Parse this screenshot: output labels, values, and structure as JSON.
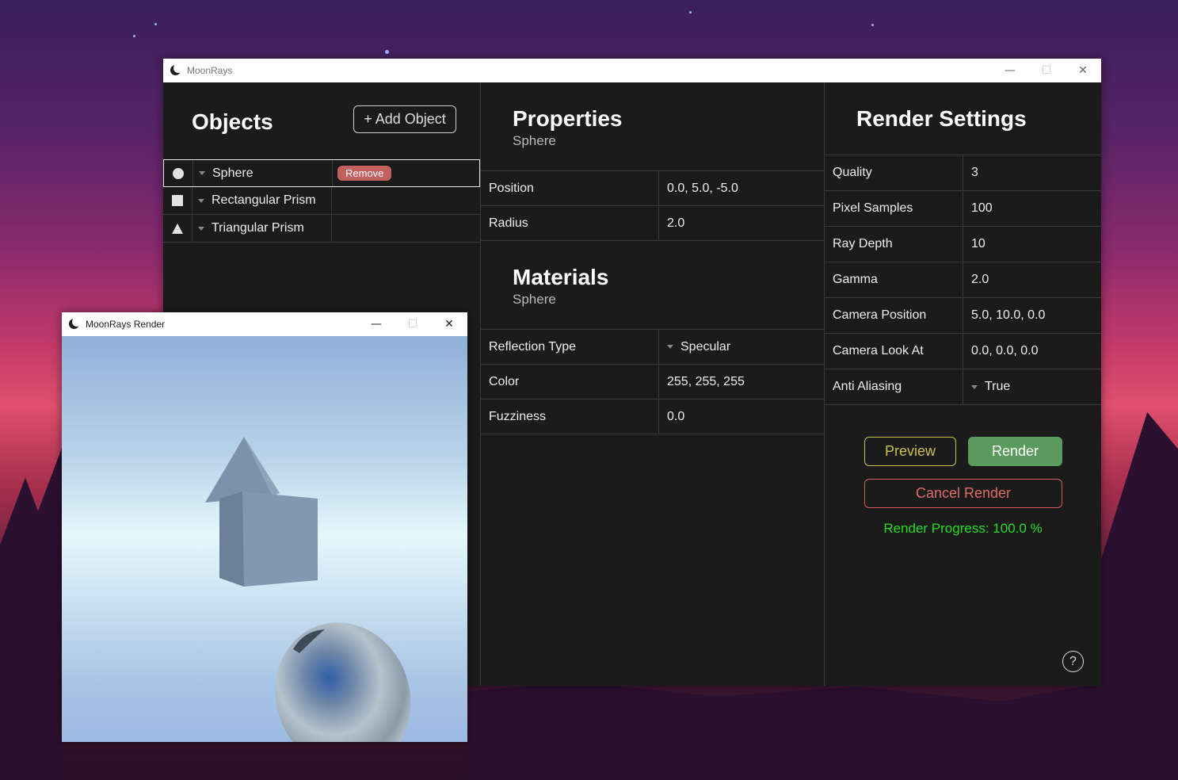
{
  "main_window": {
    "title": "MoonRays",
    "controls": {
      "minimize": "—",
      "maximize": "☐",
      "close": "✕"
    }
  },
  "objects_panel": {
    "title": "Objects",
    "add_button": "+ Add Object",
    "items": [
      {
        "shape": "circle-icon",
        "name": "Sphere",
        "selected": true,
        "remove_label": "Remove"
      },
      {
        "shape": "square-icon",
        "name": "Rectangular Prism",
        "selected": false
      },
      {
        "shape": "triangle-icon",
        "name": "Triangular Prism",
        "selected": false
      }
    ]
  },
  "properties_panel": {
    "title": "Properties",
    "subtitle": "Sphere",
    "rows": [
      {
        "label": "Position",
        "value": "0.0, 5.0, -5.0"
      },
      {
        "label": "Radius",
        "value": "2.0"
      }
    ]
  },
  "materials_panel": {
    "title": "Materials",
    "subtitle": "Sphere",
    "rows": [
      {
        "label": "Reflection Type",
        "value": "Specular"
      },
      {
        "label": "Color",
        "value": "255, 255, 255"
      },
      {
        "label": "Fuzziness",
        "value": "0.0"
      }
    ]
  },
  "render_settings": {
    "title": "Render Settings",
    "rows": [
      {
        "label": "Quality",
        "value": "3"
      },
      {
        "label": "Pixel Samples",
        "value": "100"
      },
      {
        "label": "Ray Depth",
        "value": "10"
      },
      {
        "label": "Gamma",
        "value": "2.0"
      },
      {
        "label": "Camera Position",
        "value": "5.0, 10.0, 0.0"
      },
      {
        "label": "Camera Look At",
        "value": "0.0, 0.0, 0.0"
      },
      {
        "label": "Anti Aliasing",
        "value": "True"
      }
    ],
    "preview_button": "Preview",
    "render_button": "Render",
    "cancel_button": "Cancel Render",
    "progress_text": "Render Progress: 100.0 %",
    "help_label": "?"
  },
  "render_window": {
    "title": "MoonRays Render",
    "controls": {
      "minimize": "—",
      "maximize": "☐",
      "close": "✕"
    }
  },
  "colors": {
    "panel_bg": "#1b1b1b",
    "remove": "#c46060",
    "preview": "#c9c04a",
    "render": "#5a9a5c",
    "cancel": "#e06a6a",
    "progress": "#22dd22"
  }
}
